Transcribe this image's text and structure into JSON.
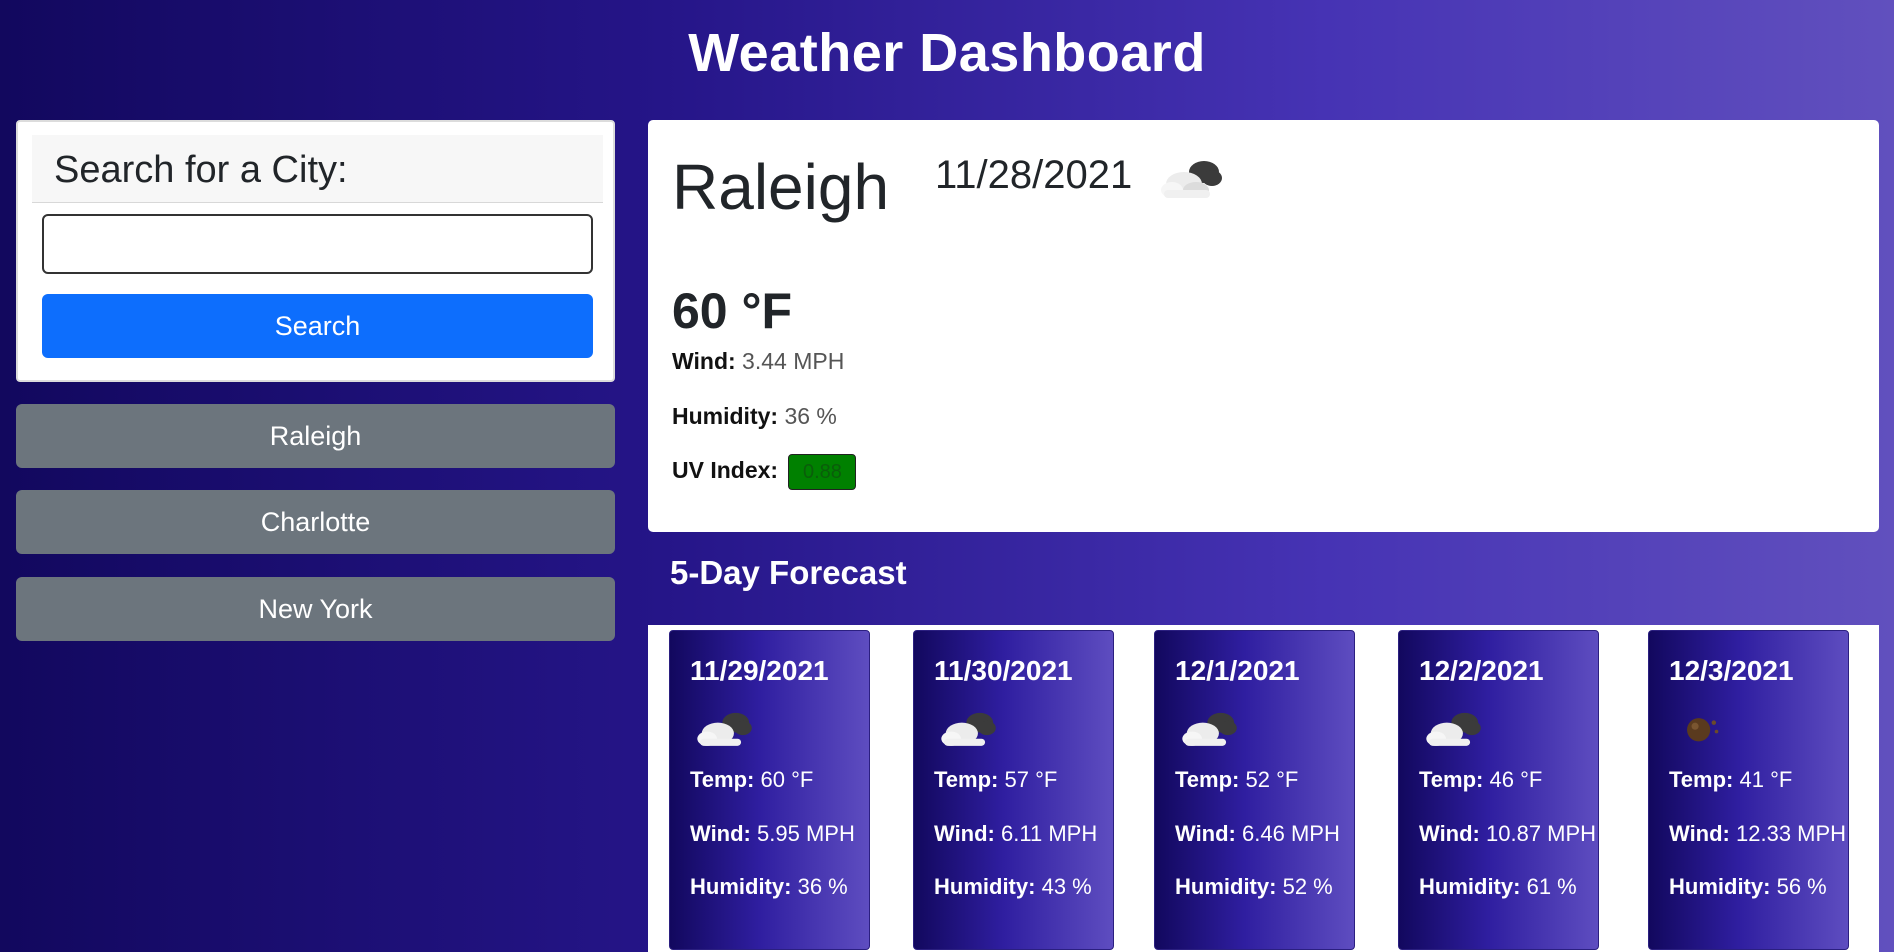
{
  "header": {
    "title": "Weather Dashboard"
  },
  "search": {
    "heading": "Search for a City:",
    "input_value": "",
    "placeholder": "",
    "button_label": "Search"
  },
  "history": [
    "Raleigh",
    "Charlotte",
    "New York"
  ],
  "current": {
    "city": "Raleigh",
    "date": "11/28/2021",
    "icon": "cloudy-icon",
    "temp": "60 °F",
    "wind_label": "Wind:",
    "wind_value": "3.44 MPH",
    "humidity_label": "Humidity:",
    "humidity_value": "36 %",
    "uv_label": "UV Index:",
    "uv_value": "0.88",
    "uv_color": "#008000"
  },
  "forecast": {
    "title": "5-Day Forecast",
    "temp_label": "Temp:",
    "wind_label": "Wind:",
    "humidity_label": "Humidity:",
    "days": [
      {
        "date": "11/29/2021",
        "icon": "cloudy-icon",
        "temp": "60 °F",
        "wind": "5.95 MPH",
        "humidity": "36 %"
      },
      {
        "date": "11/30/2021",
        "icon": "cloudy-icon",
        "temp": "57 °F",
        "wind": "6.11 MPH",
        "humidity": "43 %"
      },
      {
        "date": "12/1/2021",
        "icon": "cloudy-icon",
        "temp": "52 °F",
        "wind": "6.46 MPH",
        "humidity": "52 %"
      },
      {
        "date": "12/2/2021",
        "icon": "cloudy-icon",
        "temp": "46 °F",
        "wind": "10.87 MPH",
        "humidity": "61 %"
      },
      {
        "date": "12/3/2021",
        "icon": "night-partly-cloudy-icon",
        "temp": "41 °F",
        "wind": "12.33 MPH",
        "humidity": "56 %"
      }
    ]
  },
  "colors": {
    "primary_button": "#0d6efd",
    "history_button": "#6c757d",
    "background_start": "#12085e",
    "background_end": "#6150be"
  }
}
